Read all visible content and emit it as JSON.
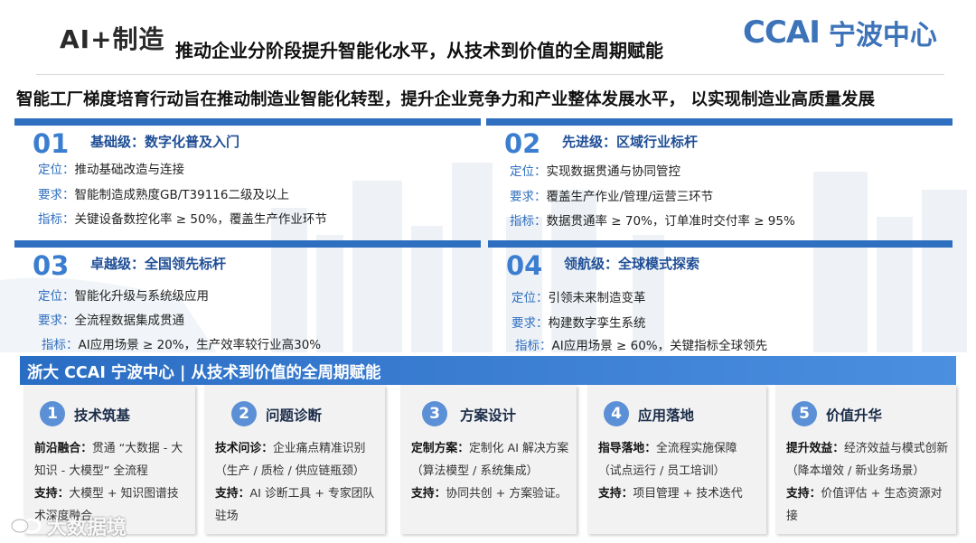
{
  "header": {
    "title": "AI+制造",
    "subtitle": "推动企业分阶段提升智能化水平，从技术到价值的全周期赋能",
    "logo_mark": "CCAI",
    "logo_text": "宁波中心"
  },
  "headline": "智能工厂梯度培育行动旨在推动制造业智能化转型，提升企业竞争力和产业整体发展水平， 以实现制造业高质量发展",
  "levels": [
    {
      "num": "01",
      "name": "基础级：数字化普及入门",
      "rows": [
        {
          "key": "定位：",
          "text": "推动基础改造与连接"
        },
        {
          "key": "要求：",
          "text": "智能制造成熟度GB/T39116二级及以上"
        },
        {
          "key": "指标：",
          "text": "关键设备数控化率 ≥ 50%，覆盖生产作业环节"
        }
      ]
    },
    {
      "num": "02",
      "name": "先进级：区域行业标杆",
      "rows": [
        {
          "key": "定位：",
          "text": "实现数据贯通与协同管控"
        },
        {
          "key": "要求：",
          "text": "覆盖生产作业/管理/运营三环节"
        },
        {
          "key": "指标：",
          "text": "数据贯通率 ≥ 70%，订单准时交付率 ≥ 95%"
        }
      ]
    },
    {
      "num": "03",
      "name": "卓越级：全国领先标杆",
      "rows": [
        {
          "key": "定位：",
          "text": "智能化升级与系统级应用"
        },
        {
          "key": "要求：",
          "text": "全流程数据集成贯通"
        },
        {
          "key": "指标：",
          "text": "AI应用场景 ≥ 20%，生产效率较行业高30%"
        }
      ]
    },
    {
      "num": "04",
      "name": "领航级：全球模式探索",
      "rows": [
        {
          "key": "定位：",
          "text": "引领未来制造变革"
        },
        {
          "key": "要求：",
          "text": "构建数字孪生系统"
        },
        {
          "key": "指标：",
          "text": "AI应用场景 ≥ 60%，关键指标全球领先"
        }
      ]
    }
  ],
  "section": {
    "title": "浙大 CCAI 宁波中心 | 从技术到价值的全周期赋能"
  },
  "cards": [
    {
      "num": "1",
      "title": "技术筑基",
      "lines": [
        {
          "label": "前沿融合：",
          "text": "贯通 “大数据 - 大知识 - 大模型” 全流程"
        },
        {
          "label": "支持：",
          "text": "大模型 + 知识图谱技术深度融合"
        }
      ]
    },
    {
      "num": "2",
      "title": "问题诊断",
      "lines": [
        {
          "label": "技术问诊：",
          "text": "企业痛点精准识别（生产 / 质检 / 供应链瓶颈）"
        },
        {
          "label": "支持：",
          "text": "AI 诊断工具 + 专家团队驻场"
        }
      ]
    },
    {
      "num": "3",
      "title": "方案设计",
      "lines": [
        {
          "label": "定制方案：",
          "text": "定制化 AI 解决方案（算法模型 / 系统集成）"
        },
        {
          "label": "支持：",
          "text": "协同共创 + 方案验证。"
        }
      ]
    },
    {
      "num": "4",
      "title": "应用落地",
      "lines": [
        {
          "label": "指导落地：",
          "text": "全流程实施保障（试点运行 / 员工培训）"
        },
        {
          "label": "支持：",
          "text": "项目管理 + 技术迭代"
        }
      ]
    },
    {
      "num": "5",
      "title": "价值升华",
      "lines": [
        {
          "label": "提升效益：",
          "text": "经济效益与模式创新（降本增效 / 新业务场景）"
        },
        {
          "label": "支持：",
          "text": "价值评估 + 生态资源对接"
        }
      ]
    }
  ],
  "watermark": {
    "text": "大数据境",
    "icon": "link-chain-icon"
  },
  "colors": {
    "accent": "#2f6fbf",
    "number_blue": "#3b7ed0",
    "badge_blue": "#5b8fd6",
    "card_bg": "#f2f2f2"
  }
}
